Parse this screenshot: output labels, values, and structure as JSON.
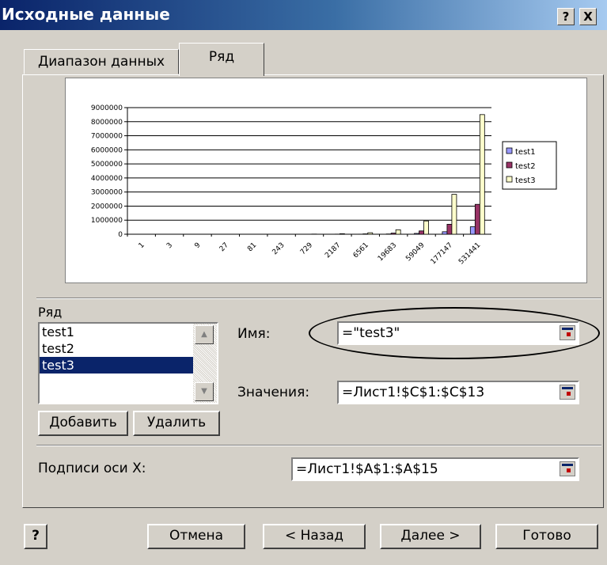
{
  "window": {
    "title": "Исходные данные",
    "help_glyph": "?",
    "close_glyph": "X"
  },
  "tabs": [
    {
      "label": "Диапазон данных",
      "active": false
    },
    {
      "label": "Ряд",
      "active": true
    }
  ],
  "chart_data": {
    "type": "bar",
    "y_tick_labels": [
      "9000000",
      "8000000",
      "7000000",
      "6000000",
      "5000000",
      "4000000",
      "3000000",
      "2000000",
      "1000000",
      "0"
    ],
    "ylim": [
      0,
      9000000
    ],
    "categories": [
      "1",
      "3",
      "9",
      "27",
      "81",
      "243",
      "729",
      "2187",
      "6561",
      "19683",
      "59049",
      "177147",
      "531441"
    ],
    "series": [
      {
        "name": "test1",
        "color": "#9999ff",
        "values": [
          1,
          3,
          9,
          27,
          81,
          243,
          729,
          2187,
          6561,
          19683,
          59049,
          177147,
          531441
        ]
      },
      {
        "name": "test2",
        "color": "#993366",
        "values": [
          4,
          12,
          36,
          108,
          324,
          972,
          2916,
          8748,
          26244,
          78732,
          236196,
          708588,
          2125764
        ]
      },
      {
        "name": "test3",
        "color": "#ffffcc",
        "values": [
          16,
          48,
          144,
          432,
          1296,
          3888,
          11664,
          34992,
          104976,
          314928,
          944784,
          2834352,
          8503056
        ]
      }
    ],
    "legend": "right",
    "grid": true
  },
  "series_section": {
    "label": "Ряд",
    "items": [
      "test1",
      "test2",
      "test3"
    ],
    "selected": "test3"
  },
  "fields": {
    "name_label": "Имя:",
    "name_value": "=\"test3\"",
    "values_label": "Значения:",
    "values_value": "=Лист1!$C$1:$C$13",
    "xaxis_label": "Подписи оси X:",
    "xaxis_value": "=Лист1!$A$1:$A$15"
  },
  "buttons": {
    "add": "Добавить",
    "remove": "Удалить",
    "cancel": "Отмена",
    "back": "< Назад",
    "next": "Далее >",
    "finish": "Готово",
    "help_glyph": "?"
  }
}
